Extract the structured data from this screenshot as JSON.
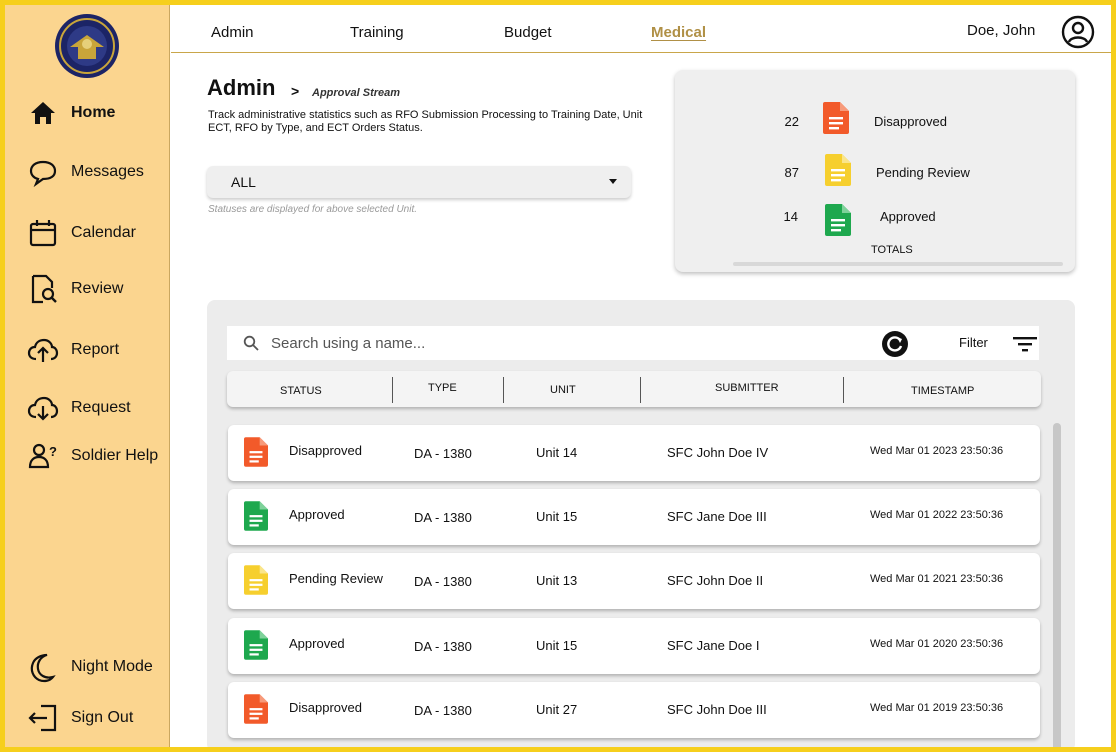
{
  "colors": {
    "sidebar_bg": "#fbd58f",
    "frame_border": "#f6cf1c",
    "accent_tab": "#b09046",
    "status_disapproved": "#f25a2a",
    "status_pending": "#f6cf2e",
    "status_approved": "#1ea84e"
  },
  "sidebar": {
    "logo_icon": "army-seal-logo",
    "items": [
      {
        "label": "Home",
        "icon": "home-icon",
        "active": true
      },
      {
        "label": "Messages",
        "icon": "chat-bubble-icon"
      },
      {
        "label": "Calendar",
        "icon": "calendar-icon"
      },
      {
        "label": "Review",
        "icon": "document-search-icon"
      },
      {
        "label": "Report",
        "icon": "cloud-upload-icon"
      },
      {
        "label": "Request",
        "icon": "cloud-download-icon"
      },
      {
        "label": "Soldier Help",
        "icon": "person-question-icon"
      }
    ],
    "bottom": [
      {
        "label": "Night Mode",
        "icon": "moon-icon"
      },
      {
        "label": "Sign Out",
        "icon": "sign-out-icon"
      }
    ]
  },
  "topbar": {
    "tabs": [
      "Admin",
      "Training",
      "Budget",
      "Medical"
    ],
    "active_tab": "Medical",
    "user_name": "Doe, John",
    "user_icon": "user-circle-icon"
  },
  "header": {
    "title": "Admin",
    "breadcrumb": "Approval Stream",
    "description": "Track administrative statistics such as RFO Submission Processing to Training Date, Unit ECT, RFO by Type, and ECT Orders Status."
  },
  "unit_select": {
    "value": "ALL",
    "note": "Statuses are displayed for above selected Unit."
  },
  "totals": {
    "label": "TOTALS",
    "items": [
      {
        "count": "22",
        "label": "Disapproved",
        "status": "disapproved"
      },
      {
        "count": "87",
        "label": "Pending Review",
        "status": "pending"
      },
      {
        "count": "14",
        "label": "Approved",
        "status": "approved"
      }
    ]
  },
  "table": {
    "search_placeholder": "Search using a name...",
    "filter_label": "Filter",
    "columns": [
      "STATUS",
      "TYPE",
      "UNIT",
      "SUBMITTER",
      "TIMESTAMP"
    ],
    "rows": [
      {
        "status": "Disapproved",
        "kind": "disapproved",
        "type": "DA - 1380",
        "unit": "Unit 14",
        "submitter": "SFC John Doe IV",
        "timestamp": "Wed Mar 01 2023 23:50:36"
      },
      {
        "status": "Approved",
        "kind": "approved",
        "type": "DA - 1380",
        "unit": "Unit 15",
        "submitter": "SFC Jane Doe III",
        "timestamp": "Wed Mar 01 2022 23:50:36"
      },
      {
        "status": "Pending Review",
        "kind": "pending",
        "type": "DA - 1380",
        "unit": "Unit 13",
        "submitter": "SFC John Doe II",
        "timestamp": "Wed Mar 01 2021 23:50:36"
      },
      {
        "status": "Approved",
        "kind": "approved",
        "type": "DA - 1380",
        "unit": "Unit 15",
        "submitter": "SFC Jane Doe I",
        "timestamp": "Wed Mar 01 2020 23:50:36"
      },
      {
        "status": "Disapproved",
        "kind": "disapproved",
        "type": "DA - 1380",
        "unit": "Unit 27",
        "submitter": "SFC John Doe III",
        "timestamp": "Wed Mar 01 2019 23:50:36"
      }
    ]
  }
}
